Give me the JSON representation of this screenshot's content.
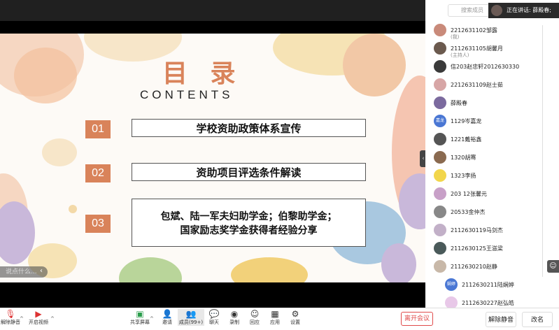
{
  "slide": {
    "title": "目 录",
    "subtitle": "CONTENTS",
    "items": [
      {
        "num": "01",
        "text": "学校资助政策体系宣传"
      },
      {
        "num": "02",
        "text": "资助项目评选条件解读"
      },
      {
        "num": "03",
        "line1": "包斌、陆一军夫妇助学金；伯黎助学金；",
        "line2": "国家励志奖学金获得者经验分享"
      }
    ]
  },
  "comment_placeholder": "说点什么...",
  "toolbar": {
    "mute": "解除静音",
    "video": "开启视频",
    "share": "共享屏幕",
    "invite": "邀请",
    "members": "成员(99+)",
    "chat": "聊天",
    "record": "录制",
    "replay": "回应",
    "apps": "应用",
    "settings": "设置",
    "leave": "离开会议"
  },
  "panel": {
    "search_placeholder": "搜索成员",
    "speaking": "正在讲话:  薛殿春;",
    "unmute_all": "解除静音",
    "rename": "改名",
    "members": [
      {
        "name": "2212631102邹露",
        "sub": "(我)",
        "color": "#c98a7a",
        "initials": ""
      },
      {
        "name": "2112631105胡馨月",
        "sub": "(主持人)",
        "color": "#6b5a4e",
        "initials": ""
      },
      {
        "name": "信203赵忠轩2012630330",
        "sub": "",
        "color": "#3a3a3a",
        "initials": ""
      },
      {
        "name": "2212631109赵士茹",
        "sub": "",
        "color": "#d7a6a6",
        "initials": ""
      },
      {
        "name": "薛殿春",
        "sub": "",
        "color": "#7b6a9e",
        "initials": ""
      },
      {
        "name": "1129岑嘉龙",
        "sub": "",
        "color": "#4a77d4",
        "initials": "嘉龙"
      },
      {
        "name": "1221戴裕鑫",
        "sub": "",
        "color": "#555555",
        "initials": ""
      },
      {
        "name": "1320胡骞",
        "sub": "",
        "color": "#8a6a50",
        "initials": ""
      },
      {
        "name": "1323李扬",
        "sub": "",
        "color": "#f2d64b",
        "initials": ""
      },
      {
        "name": "203 12张馨元",
        "sub": "",
        "color": "#c8a0c8",
        "initials": ""
      },
      {
        "name": "20533金仲杰",
        "sub": "",
        "color": "#888888",
        "initials": ""
      },
      {
        "name": "2112630119马剑杰",
        "sub": "",
        "color": "#c2b0c8",
        "initials": ""
      },
      {
        "name": "2112630125王滋梁",
        "sub": "",
        "color": "#4a5a5a",
        "initials": ""
      },
      {
        "name": "2112630210赵静",
        "sub": "",
        "color": "#c8b8a8",
        "initials": ""
      },
      {
        "name": "2112630211陆娴婷",
        "sub": "",
        "color": "#4a77d4",
        "initials": "娴婷"
      },
      {
        "name": "2112630227赵弘皓",
        "sub": "",
        "color": "#e8c8e8",
        "initials": ""
      }
    ]
  }
}
